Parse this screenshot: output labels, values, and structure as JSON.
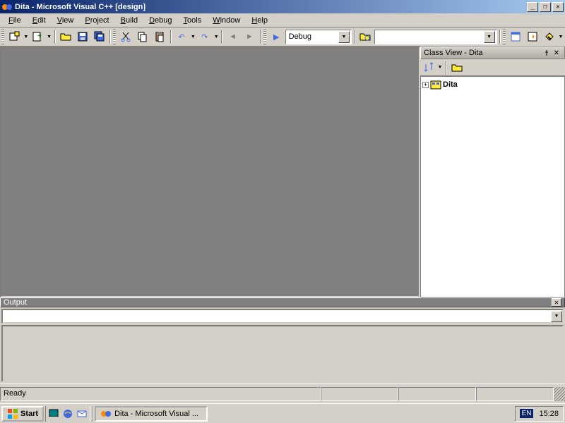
{
  "title": "Dita - Microsoft Visual C++ [design]",
  "menu": [
    "File",
    "Edit",
    "View",
    "Project",
    "Build",
    "Debug",
    "Tools",
    "Window",
    "Help"
  ],
  "toolbar": {
    "config": "Debug"
  },
  "classview": {
    "title": "Class View - Dita",
    "root": "Dita"
  },
  "output": {
    "title": "Output",
    "combo": ""
  },
  "status": {
    "ready": "Ready"
  },
  "taskbar": {
    "start": "Start",
    "task": "Dita - Microsoft Visual ...",
    "lang": "EN",
    "time": "15:28"
  }
}
